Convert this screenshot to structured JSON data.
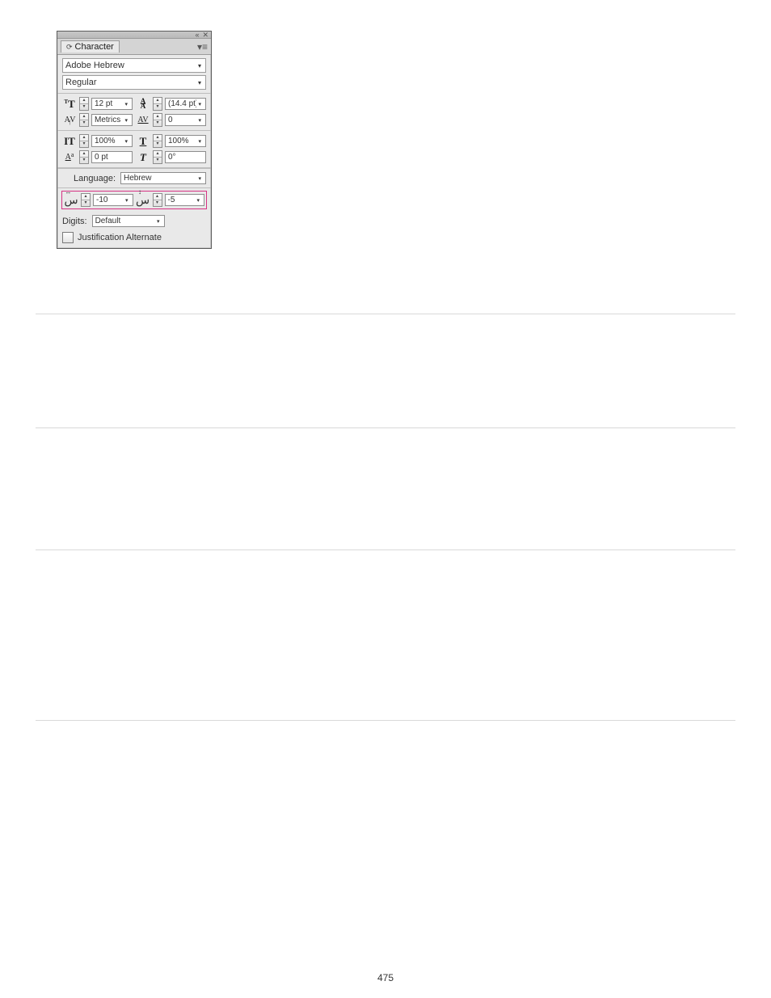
{
  "page_number": "475",
  "panel": {
    "tab_label": "Character",
    "font_family": "Adobe Hebrew",
    "font_style": "Regular",
    "font_size": "12 pt",
    "leading": "(14.4 pt)",
    "kerning": "Metrics",
    "tracking": "0",
    "vertical_scale": "100%",
    "horizontal_scale": "100%",
    "baseline_shift": "0 pt",
    "skew": "0°",
    "language_label": "Language:",
    "language_value": "Hebrew",
    "diacritic_h": "-10",
    "diacritic_v": "-5",
    "digits_label": "Digits:",
    "digits_value": "Default",
    "justification_label": "Justification Alternate"
  },
  "icons": {
    "font_size": "T",
    "leading": "A",
    "kerning": "A",
    "tracking": "AV",
    "vscale": "IT",
    "hscale": "T",
    "baseline": "A",
    "skew": "T",
    "dia_h": "س",
    "dia_v": "س"
  }
}
